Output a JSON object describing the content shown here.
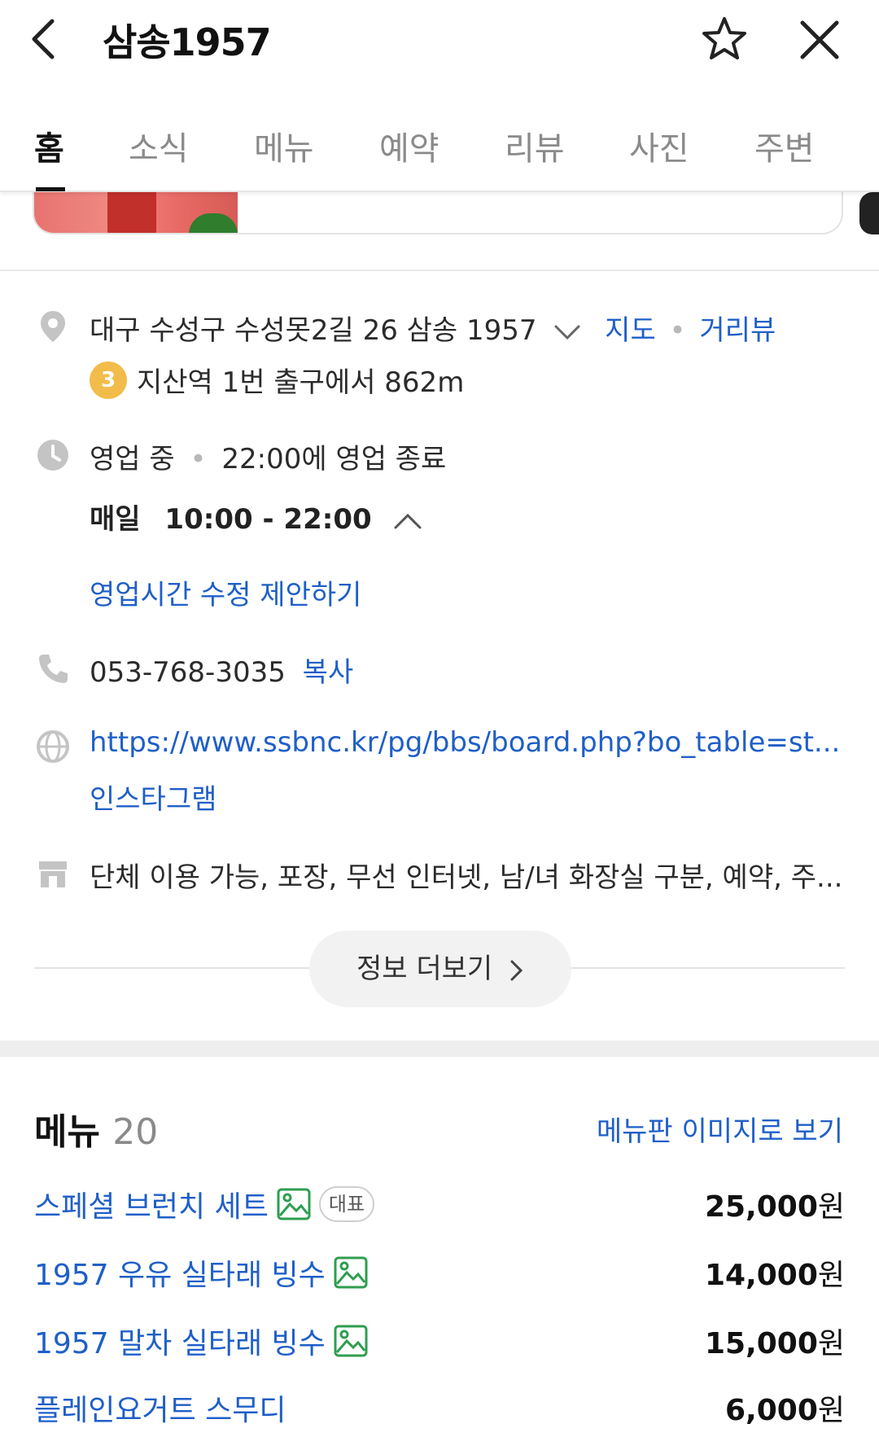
{
  "header": {
    "title": "삼송1957"
  },
  "tabs": [
    {
      "label": "홈"
    },
    {
      "label": "소식"
    },
    {
      "label": "메뉴"
    },
    {
      "label": "예약"
    },
    {
      "label": "리뷰"
    },
    {
      "label": "사진"
    },
    {
      "label": "주변"
    }
  ],
  "info": {
    "address": "대구 수성구 수성못2길 26 삼송 1957",
    "map_link": "지도",
    "street_view_link": "거리뷰",
    "subway_line": "3",
    "subway_text": "지산역 1번 출구에서 862m",
    "status": "영업 중",
    "close_text": "22:00에 영업 종료",
    "hours_day": "매일",
    "hours_time": "10:00 - 22:00",
    "suggest_hours_link": "영업시간 수정 제안하기",
    "phone": "053-768-3035",
    "copy_link": "복사",
    "website": "https://www.ssbnc.kr/pg/bbs/board.php?bo_table=st...",
    "instagram": "인스타그램",
    "amenities": "단체 이용 가능, 포장, 무선 인터넷, 남/녀 화장실 구분, 예약, 주...",
    "more_button": "정보 더보기"
  },
  "menu": {
    "title": "메뉴",
    "count": "20",
    "image_link": "메뉴판 이미지로 보기",
    "items": [
      {
        "name": "스페셜 브런치 세트",
        "price": "25,000",
        "unit": "원",
        "badge": "대표",
        "has_photo": true
      },
      {
        "name": "1957 우유 실타래 빙수",
        "price": "14,000",
        "unit": "원",
        "has_photo": true
      },
      {
        "name": "1957 말차 실타래 빙수",
        "price": "15,000",
        "unit": "원",
        "has_photo": true
      },
      {
        "name": "플레인요거트 스무디",
        "price": "6,000",
        "unit": "원",
        "has_photo": false
      }
    ]
  },
  "colors": {
    "link": "#1f5fc8",
    "subway_line3": "#f2bc4a",
    "photo_icon": "#2e9e4f"
  },
  "icons": [
    "back-icon",
    "star-icon",
    "close-icon",
    "location-pin-icon",
    "clock-icon",
    "phone-icon",
    "globe-icon",
    "store-icon",
    "photo-icon"
  ]
}
